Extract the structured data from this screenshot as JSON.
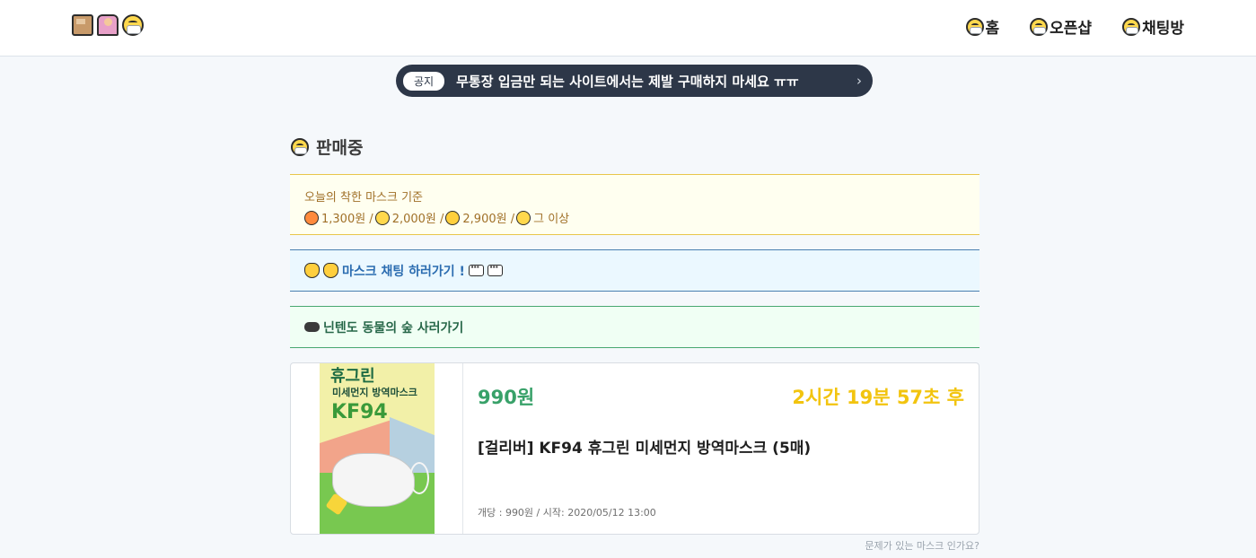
{
  "header": {
    "logo_icons": [
      "package-icon",
      "person-raising-hand-icon",
      "face-with-mask-icon"
    ],
    "nav": [
      {
        "icon": "face-with-mask-icon",
        "label": "홈"
      },
      {
        "icon": "face-with-mask-icon",
        "label": "오픈샵"
      },
      {
        "icon": "face-with-mask-icon",
        "label": "채팅방"
      }
    ]
  },
  "notice": {
    "tag": "공지",
    "text": "무통장 입금만 되는 사이트에서는 제발 구매하지 마세요 ㅠㅠ",
    "chevron": "›"
  },
  "section": {
    "title": "판매중",
    "icon": "face-with-mask-icon"
  },
  "price_guide": {
    "title": "오늘의 착한 마스크 기준",
    "tiers": [
      {
        "icon": "star-struck-icon",
        "text": "1,300원 /"
      },
      {
        "icon": "slightly-smiling-face-icon",
        "text": "2,000원 /"
      },
      {
        "icon": "thinking-face-icon",
        "text": "2,900원 /"
      },
      {
        "icon": "tired-face-icon",
        "text": "그 이상"
      }
    ]
  },
  "chat_link": {
    "icons": [
      "clapping-hands-icon",
      "clapping-hands-icon"
    ],
    "label": "마스크 채팅 하러가기 !",
    "trailing_icons": [
      "speech-bubble-icon",
      "speech-bubble-icon"
    ]
  },
  "game_link": {
    "icon": "gamepad-icon",
    "label": "닌텐도 동물의 숲 사러가기"
  },
  "product": {
    "image_text": {
      "line1": "휴그린",
      "line2": "미세먼지 방역마스크",
      "line3": "KF94"
    },
    "price": "990원",
    "countdown": "2시간 19분 57초 후",
    "name": "[걸리버] KF94 휴그린 미세먼지 방역마스크 (5매)",
    "meta": "개당 : 990원 / 시작: 2020/05/12 13:00"
  },
  "report_link": "문제가 있는 마스크 인가요?",
  "colors": {
    "notice_bg": "#2d3748",
    "price": "#38a169",
    "countdown": "#f2c40f",
    "chat": "#2b6cb0",
    "game": "#276749"
  }
}
